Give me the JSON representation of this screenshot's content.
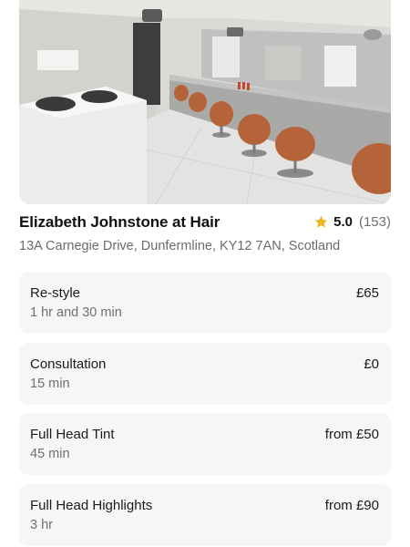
{
  "hero": {
    "icon": "salon-photo"
  },
  "venue": {
    "name": "Elizabeth Johnstone at Hair",
    "rating": {
      "score": "5.0",
      "count": "(153)",
      "star_color": "#f2b51c"
    },
    "address": "13A Carnegie Drive, Dunfermline, KY12 7AN, Scotland"
  },
  "services": [
    {
      "name": "Re-style",
      "duration": "1 hr and 30 min",
      "price": "£65"
    },
    {
      "name": "Consultation",
      "duration": "15 min",
      "price": "£0"
    },
    {
      "name": "Full Head Tint",
      "duration": "45 min",
      "price": "from £50"
    },
    {
      "name": "Full Head Highlights",
      "duration": "3 hr",
      "price": "from £90"
    }
  ],
  "colors": {
    "card_background": "#f6f6f6",
    "secondary_text": "#6b6b6b",
    "chair_leather": "#b5643a"
  }
}
